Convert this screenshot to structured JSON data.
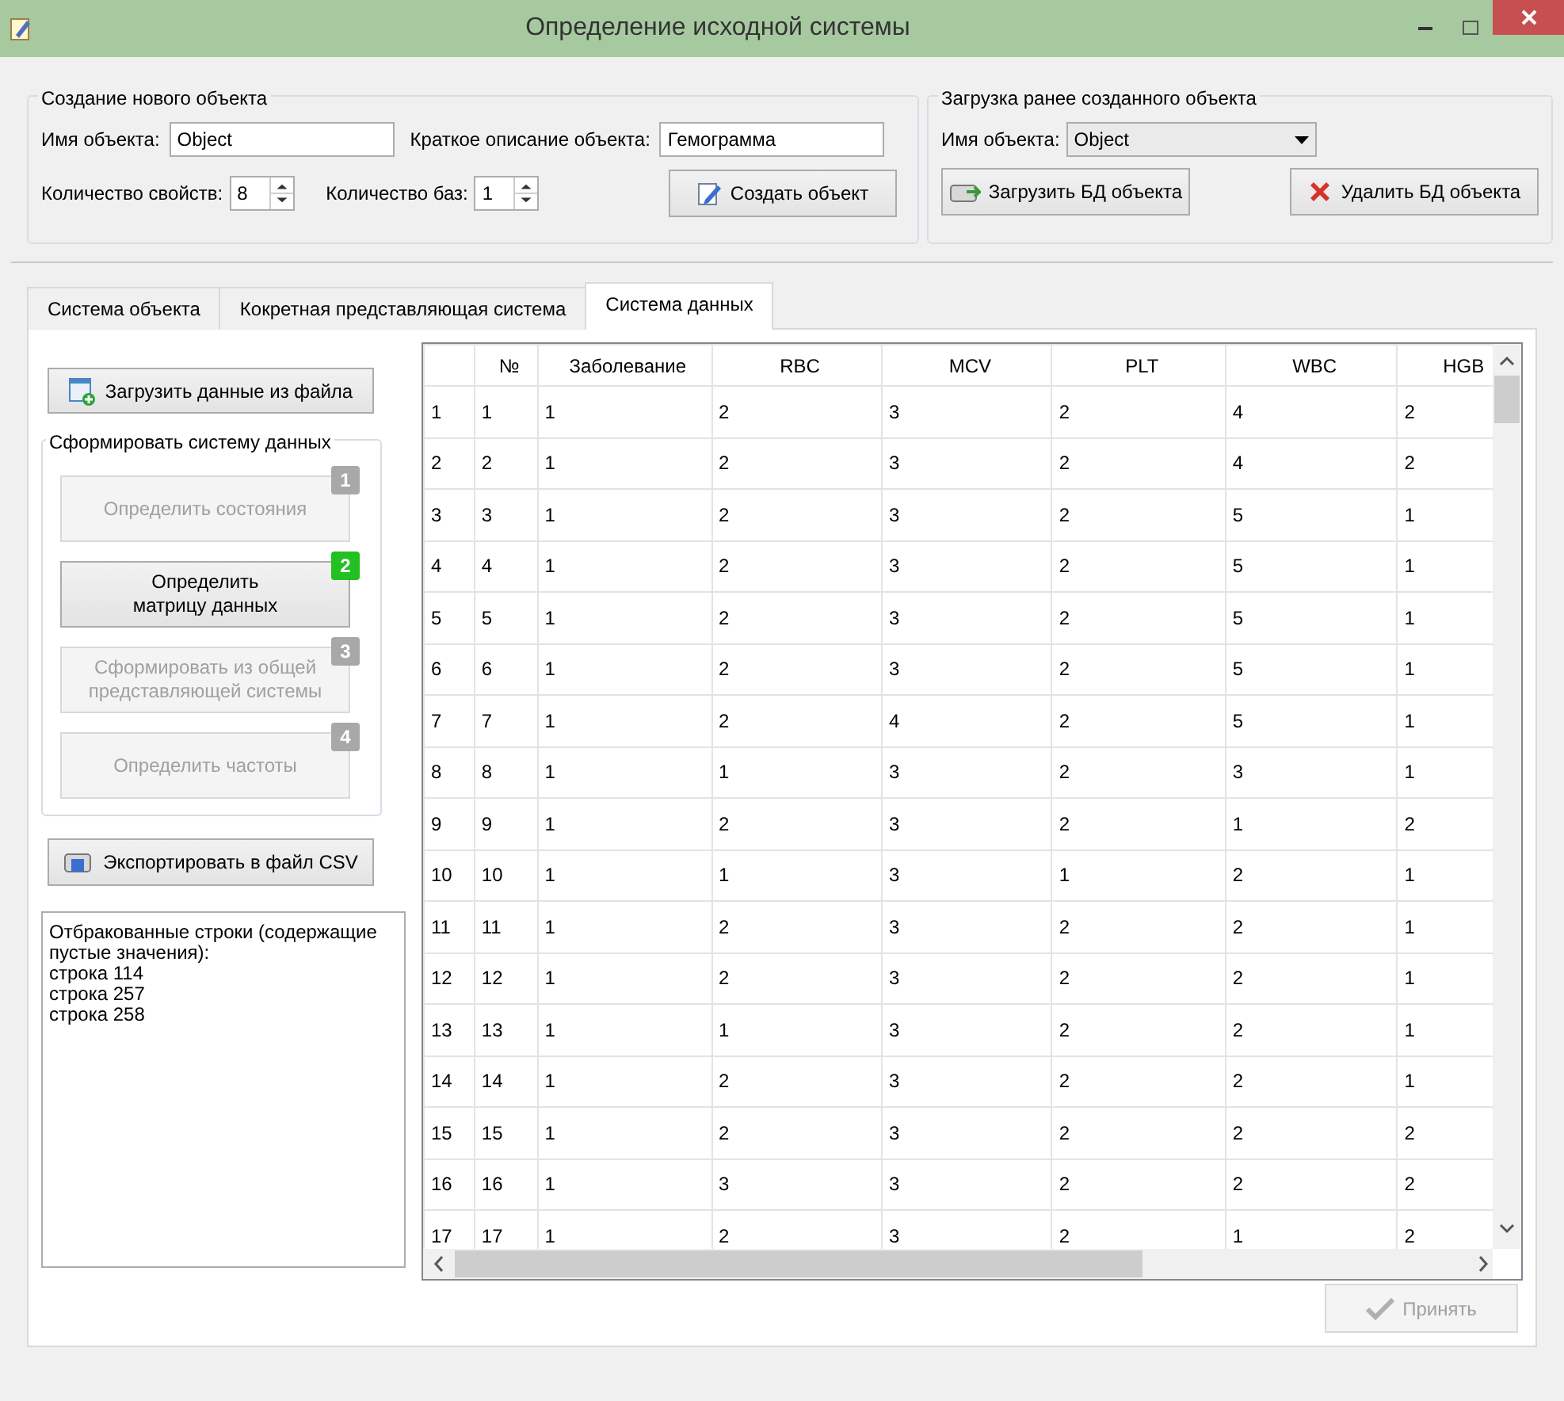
{
  "window": {
    "title": "Определение исходной системы"
  },
  "new_object": {
    "title": "Создание нового объекта",
    "name_label": "Имя объекта:",
    "name_value": "Object",
    "description_label": "Краткое описание объекта:",
    "description_value": "Гемограмма",
    "properties_label": "Количество свойств:",
    "properties_value": "8",
    "bases_label": "Количество баз:",
    "bases_value": "1",
    "create_button": "Создать объект"
  },
  "load_object": {
    "title": "Загрузка ранее созданного объекта",
    "name_label": "Имя объекта:",
    "name_value": "Object",
    "load_button": "Загрузить БД объекта",
    "delete_button": "Удалить БД объекта"
  },
  "tabs": [
    {
      "label": "Система объекта",
      "selected": false
    },
    {
      "label": "Кокретная представляющая система",
      "selected": false
    },
    {
      "label": "Система данных",
      "selected": true
    }
  ],
  "load_data_button": "Загрузить данные из файла",
  "form_group": {
    "title": "Сформировать систему данных",
    "steps": [
      {
        "label": "Определить состояния",
        "badge": "1",
        "disabled": true
      },
      {
        "label": "Определить\nматрицу данных",
        "badge": "2",
        "disabled": false
      },
      {
        "label": "Сформировать из общей\nпредставляющей системы",
        "badge": "3",
        "disabled": true
      },
      {
        "label": "Определить частоты",
        "badge": "4",
        "disabled": true
      }
    ]
  },
  "export_button": "Экспортировать в файл CSV",
  "log": {
    "text": "Отбракованные строки (содержащие пустые значения):",
    "lines": [
      "строка 114",
      "строка 257",
      "строка 258"
    ]
  },
  "table": {
    "columns": [
      "№",
      "Заболевание",
      "RBC",
      "MCV",
      "PLT",
      "WBC",
      "HGB"
    ],
    "rows": [
      {
        "header": "1",
        "cells": [
          "1",
          "1",
          "2",
          "3",
          "2",
          "4",
          "2"
        ]
      },
      {
        "header": "2",
        "cells": [
          "2",
          "1",
          "2",
          "3",
          "2",
          "4",
          "2"
        ]
      },
      {
        "header": "3",
        "cells": [
          "3",
          "1",
          "2",
          "3",
          "2",
          "5",
          "1"
        ]
      },
      {
        "header": "4",
        "cells": [
          "4",
          "1",
          "2",
          "3",
          "2",
          "5",
          "1"
        ]
      },
      {
        "header": "5",
        "cells": [
          "5",
          "1",
          "2",
          "3",
          "2",
          "5",
          "1"
        ]
      },
      {
        "header": "6",
        "cells": [
          "6",
          "1",
          "2",
          "3",
          "2",
          "5",
          "1"
        ]
      },
      {
        "header": "7",
        "cells": [
          "7",
          "1",
          "2",
          "4",
          "2",
          "5",
          "1"
        ]
      },
      {
        "header": "8",
        "cells": [
          "8",
          "1",
          "1",
          "3",
          "2",
          "3",
          "1"
        ]
      },
      {
        "header": "9",
        "cells": [
          "9",
          "1",
          "2",
          "3",
          "2",
          "1",
          "2"
        ]
      },
      {
        "header": "10",
        "cells": [
          "10",
          "1",
          "1",
          "3",
          "1",
          "2",
          "1"
        ]
      },
      {
        "header": "11",
        "cells": [
          "11",
          "1",
          "2",
          "3",
          "2",
          "2",
          "1"
        ]
      },
      {
        "header": "12",
        "cells": [
          "12",
          "1",
          "2",
          "3",
          "2",
          "2",
          "1"
        ]
      },
      {
        "header": "13",
        "cells": [
          "13",
          "1",
          "1",
          "3",
          "2",
          "2",
          "1"
        ]
      },
      {
        "header": "14",
        "cells": [
          "14",
          "1",
          "2",
          "3",
          "2",
          "2",
          "1"
        ]
      },
      {
        "header": "15",
        "cells": [
          "15",
          "1",
          "2",
          "3",
          "2",
          "2",
          "2"
        ]
      },
      {
        "header": "16",
        "cells": [
          "16",
          "1",
          "3",
          "3",
          "2",
          "2",
          "2"
        ]
      },
      {
        "header": "17",
        "cells": [
          "17",
          "1",
          "2",
          "3",
          "2",
          "1",
          "2"
        ]
      }
    ]
  },
  "accept_button": {
    "label": "Принять",
    "disabled": true
  }
}
